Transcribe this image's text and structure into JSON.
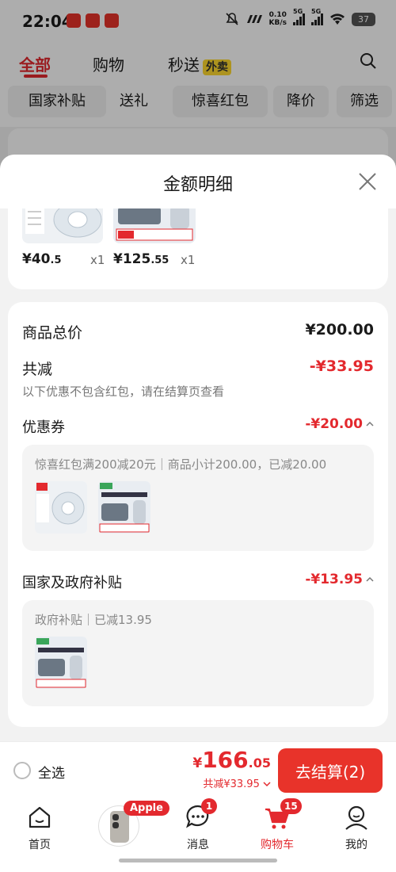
{
  "status": {
    "time": "22:04",
    "speed_value": "0.10",
    "speed_unit": "KB/s",
    "net1": "5G",
    "net2": "5G",
    "battery": "37"
  },
  "bg": {
    "tabs": [
      "全部",
      "购物",
      "秒送"
    ],
    "waimai": "外卖",
    "chips": [
      "国家补贴",
      "送礼",
      "惊喜红包",
      "降价",
      "筛选"
    ]
  },
  "sheet": {
    "title": "金额明细",
    "goods": [
      {
        "price": "¥40",
        "price_dec": ".5",
        "qty": "x1"
      },
      {
        "price": "¥125",
        "price_dec": ".55",
        "qty": "x1"
      }
    ],
    "total_label": "商品总价",
    "total_value": "¥200.00",
    "reduce_label": "共减",
    "reduce_value": "-¥33.95",
    "reduce_note": "以下优惠不包含红包，请在结算页查看",
    "coupon": {
      "label": "优惠券",
      "value": "-¥20.00",
      "desc": "惊喜红包满200减20元｜商品小计200.00，已减20.00"
    },
    "subsidy": {
      "label": "国家及政府补贴",
      "value": "-¥13.95",
      "desc": "政府补贴｜已减13.95"
    }
  },
  "bottom": {
    "select_all": "全选",
    "yen": "¥",
    "total_int": "166",
    "total_dec": ".05",
    "discount": "共减¥33.95",
    "checkout": "去结算(2)"
  },
  "tabbar": {
    "items": [
      {
        "label": "首页",
        "icon": "home-icon"
      },
      {
        "label": "",
        "icon": "phone-product"
      },
      {
        "label": "消息",
        "icon": "message-icon",
        "badge": "1"
      },
      {
        "label": "购物车",
        "icon": "cart-icon",
        "badge": "15"
      },
      {
        "label": "我的",
        "icon": "user-icon"
      }
    ],
    "apple_badge": "Apple"
  },
  "colors": {
    "accent": "#e3292e",
    "background": "#f2f2f2"
  }
}
